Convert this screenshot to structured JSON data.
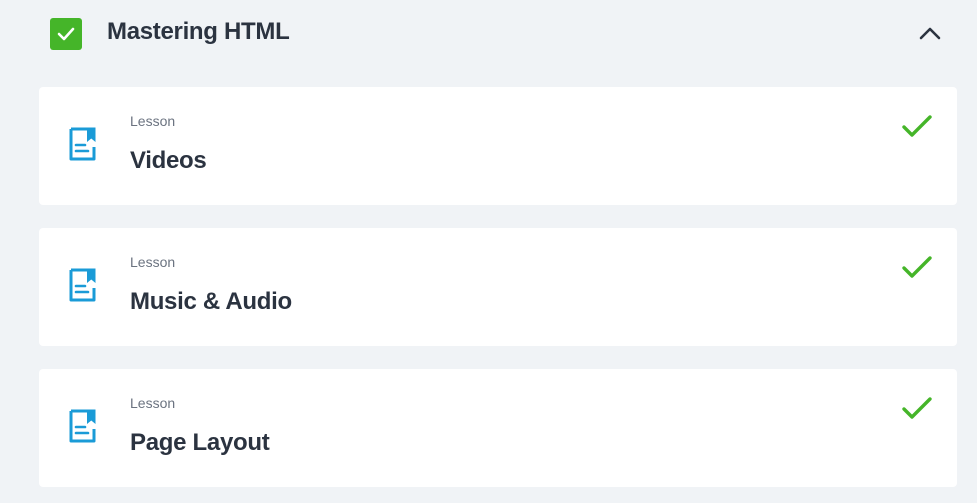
{
  "module": {
    "title": "Mastering HTML",
    "completed": true,
    "expanded": true,
    "check_icon": "checkbox-checked-icon",
    "toggle_icon": "chevron-up-icon"
  },
  "lessons": [
    {
      "type": "Lesson",
      "title": "Videos",
      "icon": "document-icon",
      "status_icon": "checkmark-icon",
      "completed": true
    },
    {
      "type": "Lesson",
      "title": "Music & Audio",
      "icon": "document-icon",
      "status_icon": "checkmark-icon",
      "completed": true
    },
    {
      "type": "Lesson",
      "title": "Page Layout",
      "icon": "document-icon",
      "status_icon": "checkmark-icon",
      "completed": true
    }
  ],
  "colors": {
    "accent_green": "#45b529",
    "icon_blue": "#1a9bd7",
    "background": "#f0f3f6",
    "card": "#ffffff",
    "title_text": "#2b3340",
    "meta_text": "#6b7380"
  }
}
